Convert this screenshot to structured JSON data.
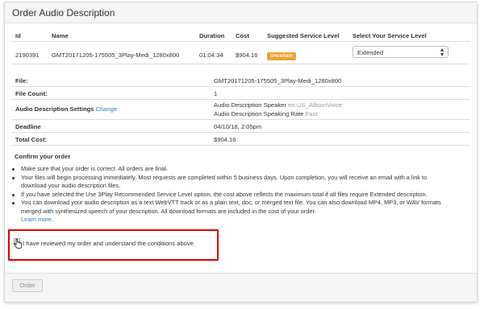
{
  "panel": {
    "title": "Order Audio Description"
  },
  "table": {
    "headers": [
      "Id",
      "Name",
      "Duration",
      "Cost",
      "Suggested Service Level",
      "Select Your Service Level"
    ],
    "row": {
      "id": "2190391",
      "name": "GMT20171205-175505_3Play-Medi_1280x800",
      "duration": "01:04:34",
      "cost": "$904.16",
      "suggested_level": "Uncertain",
      "selected_level": "Extended"
    }
  },
  "summary": {
    "file_label": "File:",
    "file_value": "GMT20171205-175505_3Play-Medi_1280x800",
    "file_count_label": "File Count:",
    "file_count_value": "1",
    "ad_settings_label": "Audio Description Settings",
    "ad_settings_link": "Change",
    "speaker_label": "Audio Description Speaker",
    "speaker_value": "en-US_AllisonVoice",
    "rate_label": "Audio Description Speaking Rate",
    "rate_value": "Fast",
    "deadline_label": "Deadline",
    "deadline_value": "04/10/18, 2:05pm",
    "total_cost_label": "Total Cost:",
    "total_cost_value": "$904.16"
  },
  "confirm": {
    "heading": "Confirm your order",
    "bullets": [
      "Make sure that your order is correct. All orders are final.",
      "Your files will begin processing immediately. Most requests are completed within 5 business days. Upon completion, you will receive an email with a link to",
      "download your audio description files.",
      "If you have selected the Use 3Play Recommended Service Level option, the cost above reflects the maximum total if all files require Extended description.",
      "You can download your audio description as a text WebVTT track or as a plain text, doc, or merged text file. You can also download MP4, MP3, or WAV formats",
      "merged with synthesized speech of your description. All download formats are included in the cost of your order."
    ],
    "learn_more": "Learn more.",
    "checkbox_label": "I have reviewed my order and understand the conditions above."
  },
  "footer": {
    "order_label": "Order"
  },
  "colors": {
    "highlight": "#e00000",
    "badge": "#f0a030",
    "link": "#2a7fbf"
  }
}
